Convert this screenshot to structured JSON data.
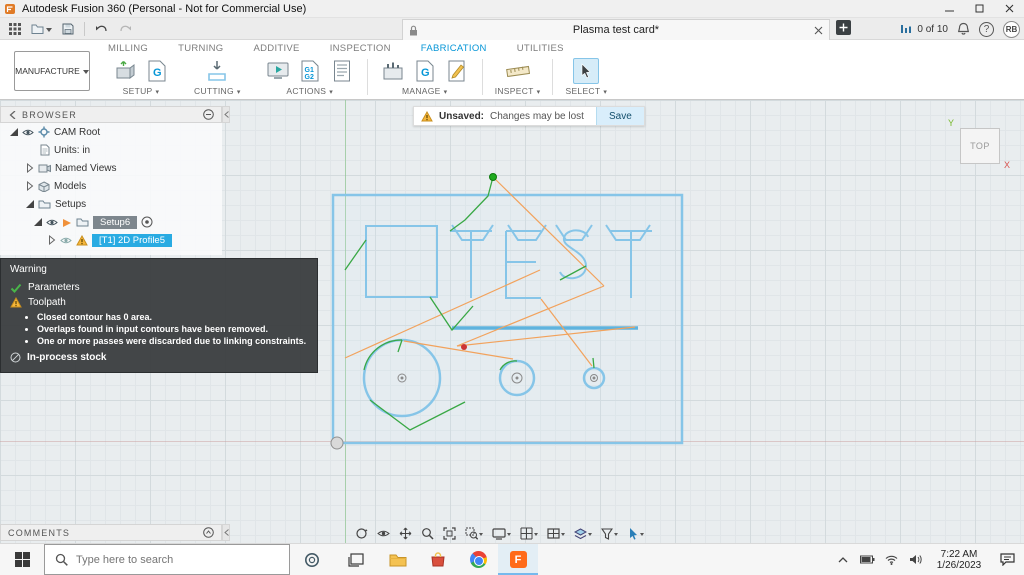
{
  "window": {
    "title": "Autodesk Fusion 360 (Personal - Not for Commercial Use)"
  },
  "toolbar": {
    "doc_title": "Plasma test card*",
    "job_badge": "0 of 10",
    "avatar": "RB"
  },
  "ribbon": {
    "workspace": "MANUFACTURE",
    "tabs": [
      {
        "label": "MILLING"
      },
      {
        "label": "TURNING"
      },
      {
        "label": "ADDITIVE"
      },
      {
        "label": "INSPECTION"
      },
      {
        "label": "FABRICATION"
      },
      {
        "label": "UTILITIES"
      }
    ],
    "groups": [
      {
        "label": "SETUP"
      },
      {
        "label": "CUTTING"
      },
      {
        "label": "ACTIONS"
      },
      {
        "label": "MANAGE"
      },
      {
        "label": "INSPECT"
      },
      {
        "label": "SELECT"
      }
    ]
  },
  "browser": {
    "title": "BROWSER",
    "items": [
      {
        "label": "CAM Root"
      },
      {
        "label": "Units: in"
      },
      {
        "label": "Named Views"
      },
      {
        "label": "Models"
      },
      {
        "label": "Setups"
      },
      {
        "label": "Setup6"
      },
      {
        "label": "[T1] 2D Profile5"
      }
    ]
  },
  "warning_panel": {
    "title": "Warning",
    "parameters": "Parameters",
    "toolpath": "Toolpath",
    "bullets": [
      "Closed contour has 0 area.",
      "Overlaps found in input contours have been removed.",
      "One or more passes were discarded due to linking constraints."
    ],
    "stock": "In-process stock"
  },
  "unsaved": {
    "label": "Unsaved:",
    "message": "Changes may be lost",
    "save": "Save"
  },
  "viewcube": {
    "face": "TOP",
    "axis_y": "Y",
    "axis_x": "X"
  },
  "comments": {
    "title": "COMMENTS"
  },
  "taskbar": {
    "search_placeholder": "Type here to search",
    "time": "7:22 AM",
    "date": "1/26/2023"
  },
  "icons": {
    "gcode": "G",
    "g1": "G1",
    "g2": "G2",
    "help": "?",
    "fusion": "F"
  },
  "colors": {
    "accent_blue": "#0696d7",
    "selection_blue": "#29abe2",
    "warning_yellow": "#f6b73c",
    "toolpath_green": "#39a845",
    "rapid_orange": "#f2a25c",
    "geometry_blue": "#86c5e8"
  }
}
